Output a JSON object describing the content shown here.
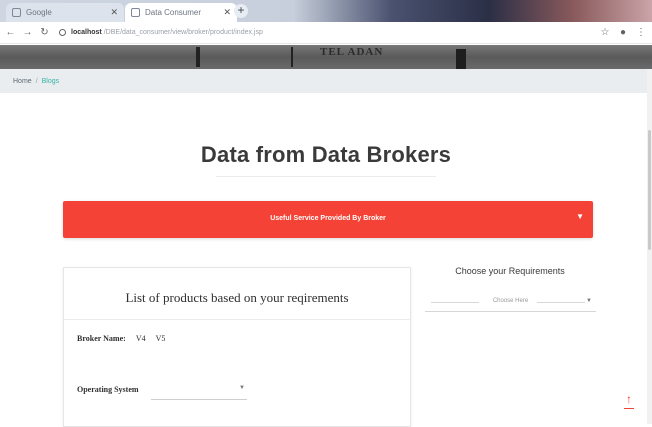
{
  "browser": {
    "tabs": [
      {
        "label": "Google",
        "active": false
      },
      {
        "label": "Data Consumer",
        "active": true
      }
    ],
    "new_tab_label": "+",
    "nav": {
      "back": "←",
      "forward": "→",
      "reload": "↻"
    },
    "address": {
      "host": "localhost",
      "path": "/DBE/data_consumer/view/broker/product/index.jsp"
    },
    "toolbar_right": [
      "☆",
      "●",
      "⋮"
    ]
  },
  "hero": {
    "stamp_text": "TEL ADAN"
  },
  "breadcrumb": {
    "home": "Home",
    "separator": "/",
    "current": "Blogs"
  },
  "main": {
    "title": "Data from Data Brokers",
    "accordion": {
      "label": "Useful Service Provided By Broker",
      "caret": "▼"
    },
    "products_card": {
      "heading": "List of products based on your reqirements",
      "broker_label": "Broker Name:",
      "broker_options": [
        "V4",
        "V5"
      ],
      "os_label": "Operating System",
      "os_value": ""
    },
    "requirements": {
      "title": "Choose your Requirements",
      "placeholder": "Choose Here"
    },
    "back_to_top": "↑"
  },
  "colors": {
    "accent_red": "#f44336",
    "breadcrumb_active": "#39b3a4"
  }
}
